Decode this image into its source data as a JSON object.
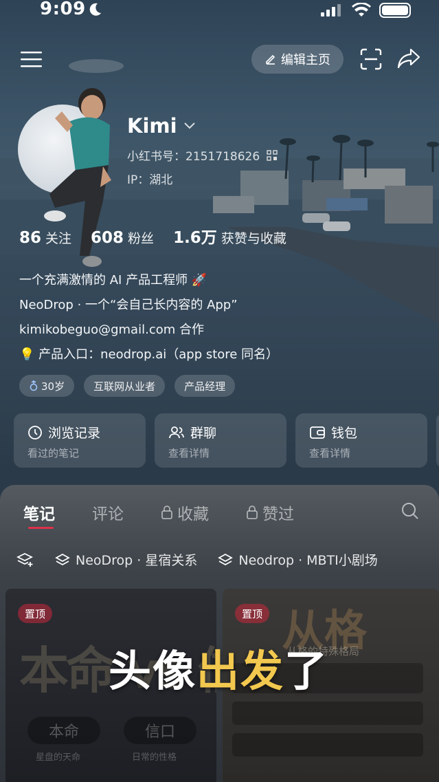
{
  "status_bar": {
    "time": "9:09"
  },
  "header": {
    "edit_label": "编辑主页"
  },
  "profile": {
    "name": "Kimi",
    "id_line": "小红书号：2151718626",
    "ip_line": "IP：湖北"
  },
  "stats": [
    {
      "value": "86",
      "label": "关注"
    },
    {
      "value": "608",
      "label": "粉丝"
    },
    {
      "value": "1.6万",
      "label": "获赞与收藏"
    }
  ],
  "bio": [
    "一个充满激情的 AI 产品工程师 🚀",
    "NeoDrop · 一个“会自己长内容的 App”",
    "kimikobeguo@gmail.com 合作",
    "💡 产品入口：neodrop.ai（app store 同名）"
  ],
  "tags": [
    "30岁",
    "互联网从业者",
    "产品经理"
  ],
  "cards": [
    {
      "title": "浏览记录",
      "sub": "看过的笔记"
    },
    {
      "title": "群聊",
      "sub": "查看详情"
    },
    {
      "title": "钱包",
      "sub": "查看详情"
    }
  ],
  "tabs": [
    "笔记",
    "评论",
    "收藏",
    "赞过"
  ],
  "chips": [
    "NeoDrop · 星宿关系",
    "Neodrop · MBTI小剧场"
  ],
  "posts": [
    {
      "pin": "置顶",
      "big": "本命 vs 信口",
      "pill_a": "本命",
      "pill_b": "信口",
      "label_a": "星盘的天命",
      "label_b": "日常的性格"
    },
    {
      "pin": "置顶",
      "big": "从格",
      "sub": "从格的特殊格局"
    }
  ],
  "caption": {
    "part1": "头像",
    "part2": "出发",
    "part3": "了"
  },
  "colors": {
    "accent": "#e0314b",
    "caption_yellow": "#f3c84f"
  }
}
